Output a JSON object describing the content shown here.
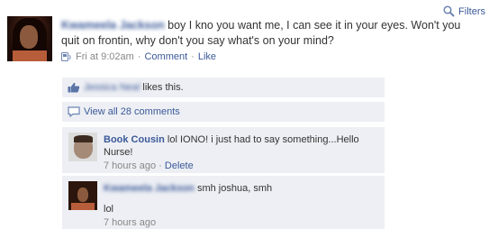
{
  "header": {
    "filters_label": "Filters",
    "filters_icon": "magnifier-icon"
  },
  "story": {
    "author_name": "Kwameela Jackson",
    "message": "boy I kno you want me, I can see it in your eyes. Won't you quit on frontin, why don't you say what's on your mind?",
    "timestamp": "Fri at 9:02am",
    "comment_label": "Comment",
    "like_label": "Like",
    "source_icon": "mobile-sms-icon"
  },
  "feedback": {
    "liker_name": "Jessica Neal",
    "likes_suffix": "likes this.",
    "view_all_label": "View all 28 comments"
  },
  "comments": [
    {
      "author": "Book Cousin",
      "text": "lol IONO! i just had to say something...Hello Nurse!",
      "time": "7 hours ago",
      "delete_label": "Delete"
    },
    {
      "author": "Kwameela Jackson",
      "text": "smh joshua, smh",
      "text2": "lol",
      "time": "7 hours ago"
    }
  ],
  "colors": {
    "link": "#3b5998",
    "ufi_bg": "#edeff4",
    "meta": "#888888"
  }
}
